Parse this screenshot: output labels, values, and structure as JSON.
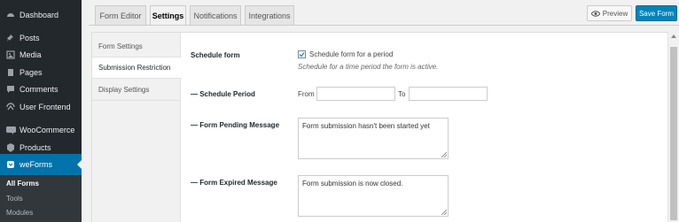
{
  "admin_menu": {
    "items": [
      {
        "label": "Dashboard",
        "icon": "dashboard-icon"
      },
      {
        "label": "Posts",
        "icon": "pin-icon"
      },
      {
        "label": "Media",
        "icon": "media-icon"
      },
      {
        "label": "Pages",
        "icon": "pages-icon"
      },
      {
        "label": "Comments",
        "icon": "comments-icon"
      },
      {
        "label": "User Frontend",
        "icon": "user-frontend-icon"
      },
      {
        "label": "WooCommerce",
        "icon": "woocommerce-icon"
      },
      {
        "label": "Products",
        "icon": "products-icon"
      },
      {
        "label": "weForms",
        "icon": "weforms-icon"
      }
    ],
    "submenu": [
      "All Forms",
      "Tools",
      "Modules"
    ],
    "accent_color": "#0073aa"
  },
  "tabs": [
    "Form Editor",
    "Settings",
    "Notifications",
    "Integrations"
  ],
  "toolbar": {
    "preview_label": "Preview",
    "save_label": "Save Form"
  },
  "settings_nav": [
    "Form Settings",
    "Submission Restriction",
    "Display Settings"
  ],
  "form": {
    "schedule_form_label": "Schedule form",
    "schedule_checkbox_label": "Schedule form for a period",
    "schedule_help": "Schedule for a time period the form is active.",
    "schedule_period_label": "— Schedule Period",
    "from_label": "From",
    "to_label": "To",
    "from_value": "",
    "to_value": "",
    "pending_label": "— Form Pending Message",
    "pending_message": "Form submission hasn't been started yet",
    "expired_label": "— Form Expired Message",
    "expired_message": "Form submission is now closed."
  }
}
